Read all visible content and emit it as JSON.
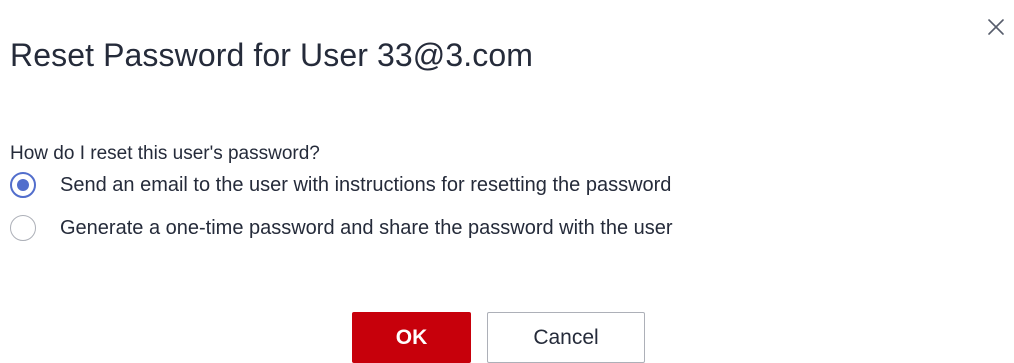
{
  "dialog": {
    "title": "Reset Password for User 33@3.com",
    "question": "How do I reset this user's password?",
    "options": [
      {
        "label": "Send an email to the user with instructions for resetting the password",
        "selected": true
      },
      {
        "label": "Generate a one-time password and share the password with the user",
        "selected": false
      }
    ],
    "buttons": {
      "ok_label": "OK",
      "cancel_label": "Cancel"
    },
    "close_icon": "close-icon"
  },
  "colors": {
    "primary": "#c7000b",
    "radio_selected": "#526ecc",
    "text": "#252b3a",
    "border": "#adb0b8"
  }
}
